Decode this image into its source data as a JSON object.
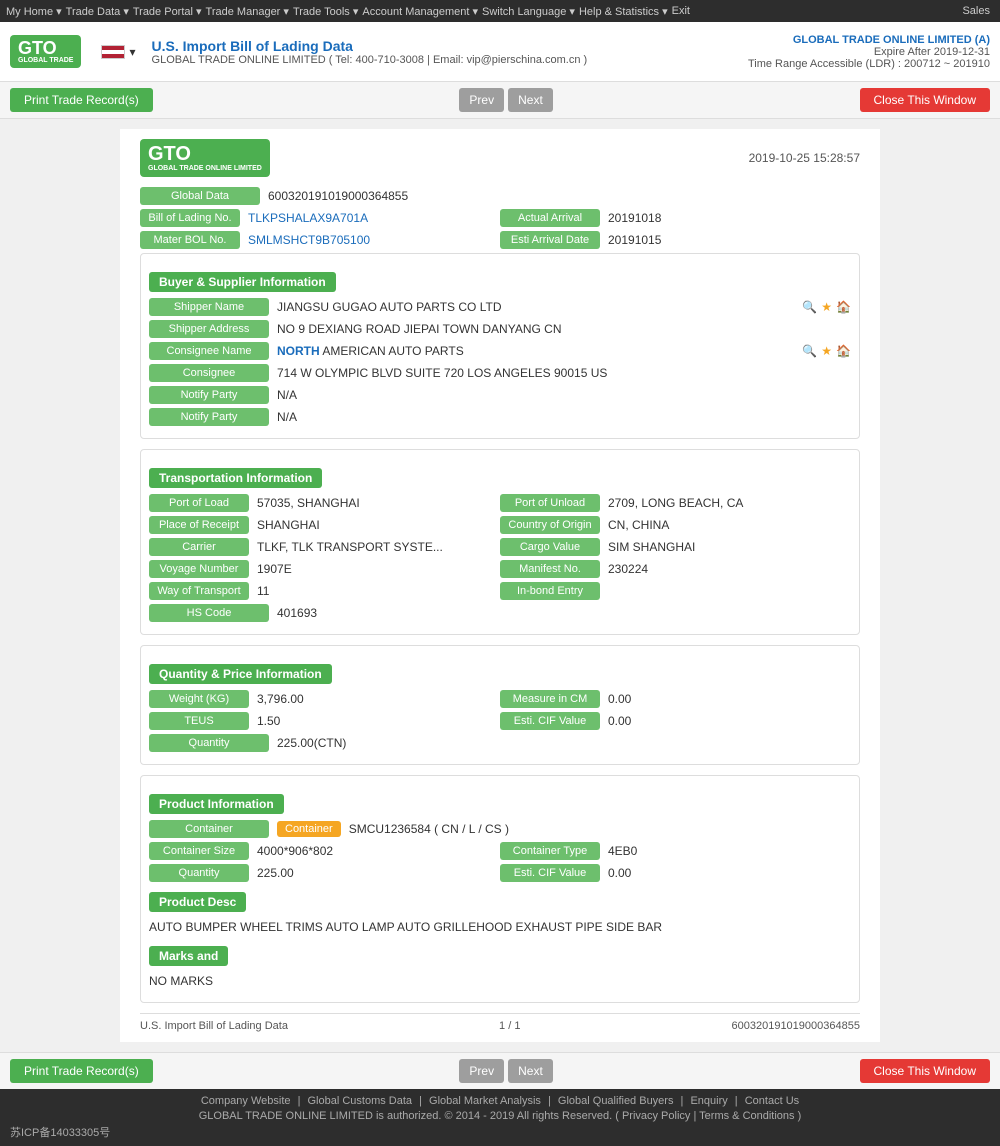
{
  "topnav": {
    "items": [
      "My Home",
      "Trade Data",
      "Trade Portal",
      "Trade Manager",
      "Trade Tools",
      "Account Management",
      "Switch Language",
      "Help & Statistics",
      "Exit"
    ],
    "sales": "Sales"
  },
  "header": {
    "title": "U.S. Import Bill of Lading Data",
    "company_line": "GLOBAL TRADE ONLINE LIMITED ( Tel: 400-710-3008 | Email: vip@pierschina.com.cn )",
    "account_company": "GLOBAL TRADE ONLINE LIMITED (A)",
    "expire": "Expire After 2019-12-31",
    "time_range": "Time Range Accessible (LDR) : 200712 ~ 201910"
  },
  "toolbar": {
    "print_label": "Print Trade Record(s)",
    "prev_label": "Prev",
    "next_label": "Next",
    "close_label": "Close This Window"
  },
  "doc": {
    "timestamp": "2019-10-25 15:28:57",
    "global_data_label": "Global Data",
    "global_data_value": "600320191019000364855",
    "bol_label": "Bill of Lading No.",
    "bol_value": "TLKPSHALAX9A701A",
    "actual_arrival_label": "Actual Arrival",
    "actual_arrival_value": "20191018",
    "master_bol_label": "Mater BOL No.",
    "master_bol_value": "SMLMSHCT9B705100",
    "esti_arrival_label": "Esti Arrival Date",
    "esti_arrival_value": "20191015",
    "buyer_supplier_section": "Buyer & Supplier Information",
    "shipper_name_label": "Shipper Name",
    "shipper_name_value": "JIANGSU GUGAO AUTO PARTS CO LTD",
    "shipper_address_label": "Shipper Address",
    "shipper_address_value": "NO 9 DEXIANG ROAD JIEPAI TOWN DANYANG CN",
    "consignee_name_label": "Consignee Name",
    "consignee_name_value": "NORTH AMERICAN AUTO PARTS",
    "consignee_label": "Consignee",
    "consignee_value": "714 W OLYMPIC BLVD SUITE 720 LOS ANGELES 90015 US",
    "notify_party_label": "Notify Party",
    "notify_party_value1": "N/A",
    "notify_party_value2": "N/A",
    "transport_section": "Transportation Information",
    "port_load_label": "Port of Load",
    "port_load_value": "57035, SHANGHAI",
    "port_unload_label": "Port of Unload",
    "port_unload_value": "2709, LONG BEACH, CA",
    "place_receipt_label": "Place of Receipt",
    "place_receipt_value": "SHANGHAI",
    "country_origin_label": "Country of Origin",
    "country_origin_value": "CN, CHINA",
    "carrier_label": "Carrier",
    "carrier_value": "TLKF, TLK TRANSPORT SYSTE...",
    "cargo_value_label": "Cargo Value",
    "cargo_value_value": "SIM SHANGHAI",
    "voyage_label": "Voyage Number",
    "voyage_value": "1907E",
    "manifest_label": "Manifest No.",
    "manifest_value": "230224",
    "way_transport_label": "Way of Transport",
    "way_transport_value": "11",
    "inbond_label": "In-bond Entry",
    "inbond_value": "",
    "hs_code_label": "HS Code",
    "hs_code_value": "401693",
    "quantity_section": "Quantity & Price Information",
    "weight_label": "Weight (KG)",
    "weight_value": "3,796.00",
    "measure_label": "Measure in CM",
    "measure_value": "0.00",
    "teus_label": "TEUS",
    "teus_value": "1.50",
    "esti_cif_label": "Esti. CIF Value",
    "esti_cif_value": "0.00",
    "quantity_label": "Quantity",
    "quantity_value": "225.00(CTN)",
    "product_section": "Product Information",
    "container_label": "Container",
    "container_value": "SMCU1236584 ( CN / L / CS )",
    "container_size_label": "Container Size",
    "container_size_value": "4000*906*802",
    "container_type_label": "Container Type",
    "container_type_value": "4EB0",
    "product_quantity_label": "Quantity",
    "product_quantity_value": "225.00",
    "product_esti_cif_label": "Esti. CIF Value",
    "product_esti_cif_value": "0.00",
    "product_desc_label": "Product Desc",
    "product_desc_value": "AUTO BUMPER WHEEL TRIMS AUTO LAMP AUTO GRILLEHOOD EXHAUST PIPE SIDE BAR",
    "marks_label": "Marks and",
    "marks_value": "NO MARKS",
    "footer_left": "U.S. Import Bill of Lading Data",
    "footer_page": "1 / 1",
    "footer_right": "600320191019000364855"
  },
  "bottom_toolbar": {
    "print_label": "Print Trade Record(s)",
    "prev_label": "Prev",
    "next_label": "Next",
    "close_label": "Close This Window"
  },
  "site_footer": {
    "links": [
      "Company Website",
      "Global Customs Data",
      "Global Market Analysis",
      "Global Qualified Buyers",
      "Enquiry",
      "Contact Us"
    ],
    "copyright": "GLOBAL TRADE ONLINE LIMITED is authorized. © 2014 - 2019 All rights Reserved.  (  Privacy Policy  |  Terms & Conditions  )",
    "icp": "苏ICP备14033305号"
  }
}
